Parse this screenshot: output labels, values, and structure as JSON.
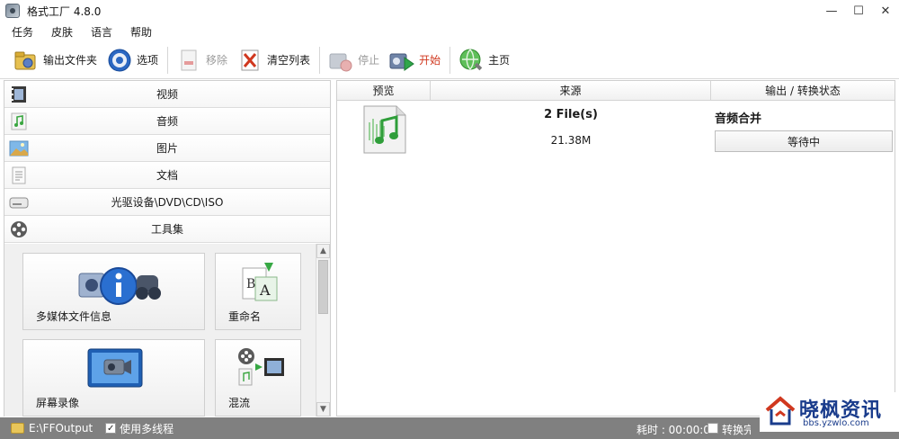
{
  "window": {
    "title": "格式工厂 4.8.0",
    "minimize": "—",
    "maximize": "☐",
    "close": "✕"
  },
  "menu": [
    "任务",
    "皮肤",
    "语言",
    "帮助"
  ],
  "toolbar": {
    "output_folder": "输出文件夹",
    "options": "选项",
    "remove": "移除",
    "clear_list": "清空列表",
    "stop": "停止",
    "start": "开始",
    "home": "主页"
  },
  "categories": [
    "视频",
    "音频",
    "图片",
    "文档",
    "光驱设备\\DVD\\CD\\ISO",
    "工具集"
  ],
  "tools": [
    "多媒体文件信息",
    "重命名",
    "屏幕录像",
    "混流"
  ],
  "scrollbar": {
    "up": "▲",
    "down": "▼"
  },
  "table": {
    "headers": [
      "预览",
      "来源",
      "输出 / 转换状态"
    ],
    "row": {
      "files": "2 File(s)",
      "size": "21.38M",
      "task": "音频合并",
      "status": "等待中"
    }
  },
  "statusbar": {
    "path": "E:\\FFOutput",
    "multithread": "使用多线程",
    "multithread_checked": "✓",
    "elapsed": "耗时 : 00:00:00",
    "after_done": "转换完成后"
  },
  "watermark": {
    "title": "晓枫资讯",
    "url": "bbs.yzwlo.com"
  },
  "colors": {
    "accent_red": "#d0381f",
    "watermark_blue": "#1a3c8c",
    "statusbar": "#808080"
  }
}
